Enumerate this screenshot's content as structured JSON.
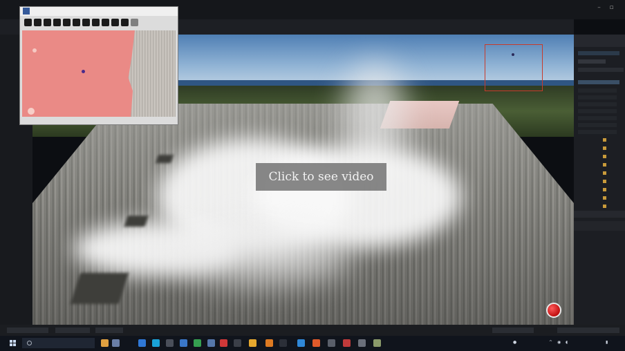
{
  "editor": {
    "window_title": "",
    "settings_label": ""
  },
  "viewport": {
    "overlay_button": "Click to see video"
  },
  "plugin_window": {
    "title": "",
    "status": ""
  },
  "outliner": {
    "title": ""
  },
  "taskbar": {
    "search_placeholder": "",
    "weather_text": "",
    "time": "",
    "date": ""
  },
  "colors": {
    "mask_pink": "#ea8a86",
    "selection_red": "#c83a2a",
    "record_red": "#d01818"
  }
}
